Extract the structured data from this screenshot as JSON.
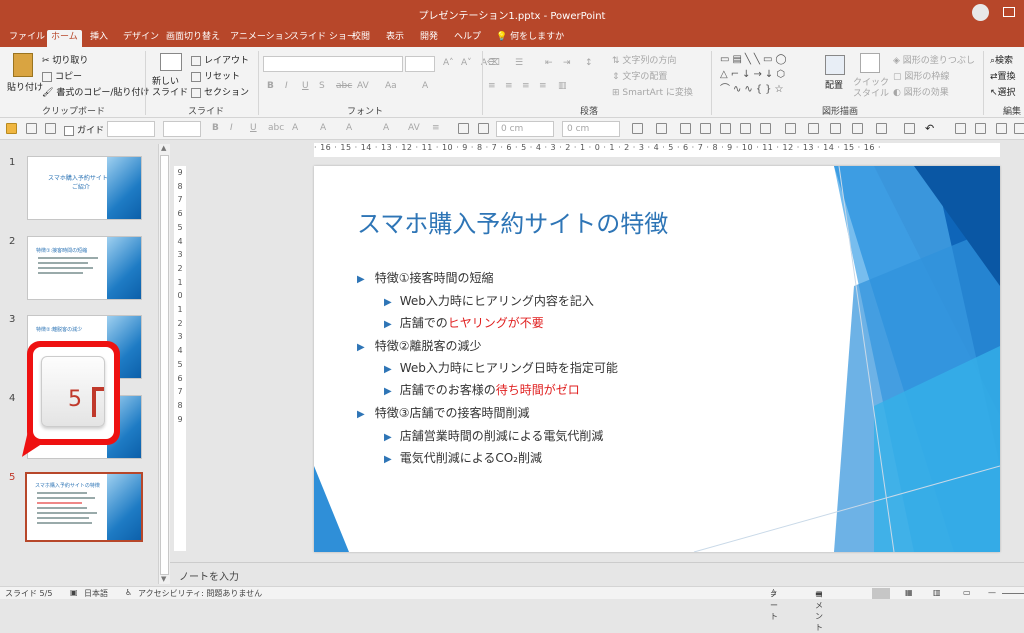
{
  "app": {
    "title": "プレゼンテーション1.pptx  -  PowerPoint"
  },
  "tabs": [
    {
      "label": "ファイル"
    },
    {
      "label": "ホーム"
    },
    {
      "label": "挿入"
    },
    {
      "label": "デザイン"
    },
    {
      "label": "画面切り替え"
    },
    {
      "label": "アニメーション"
    },
    {
      "label": "スライド ショー"
    },
    {
      "label": "校閲"
    },
    {
      "label": "表示"
    },
    {
      "label": "開発"
    },
    {
      "label": "ヘルプ"
    },
    {
      "label": "何をしますか"
    }
  ],
  "ribbon": {
    "clipboard": {
      "paste": "貼り付け",
      "cut": "切り取り",
      "copy": "コピー",
      "format_painter": "書式のコピー/貼り付け",
      "group": "クリップボード"
    },
    "slides": {
      "new_slide": "新しい\nスライド",
      "layout": "レイアウト",
      "reset": "リセット",
      "section": "セクション",
      "group": "スライド"
    },
    "font": {
      "group": "フォント"
    },
    "paragraph": {
      "text_direction": "文字列の方向",
      "align_text": "文字の配置",
      "smartart": "SmartArt に変換",
      "group": "段落"
    },
    "drawing": {
      "arrange": "配置",
      "quick_styles": "クイック\nスタイル",
      "shape_fill": "図形の塗りつぶし",
      "shape_outline": "図形の枠線",
      "shape_effects": "図形の効果",
      "group": "図形描画"
    },
    "editing": {
      "find": "検索",
      "replace": "置換",
      "select": "選択",
      "group": "編集"
    }
  },
  "qat": {
    "guides": "ガイド",
    "width": "0 cm",
    "height": "0 cm"
  },
  "ruler": {
    "h": "· 16 · 15 · 14 · 13 · 12 · 11 · 10 · 9 · 8 · 7 · 6 · 5 · 4 · 3 · 2 · 1 · 0 · 1 · 2 · 3 · 4 · 5 · 6 · 7 · 8 · 9 · 10 · 11 · 12 · 13 · 14 · 15 · 16 ·",
    "v": [
      "9",
      "8",
      "7",
      "6",
      "5",
      "4",
      "3",
      "2",
      "1",
      "0",
      "1",
      "2",
      "3",
      "4",
      "5",
      "6",
      "7",
      "8",
      "9"
    ]
  },
  "thumbnails": [
    {
      "num": "1",
      "title": "スマホ購入予約サイトの\nご紹介"
    },
    {
      "num": "2",
      "title": "特徴①:接客時間の短縮"
    },
    {
      "num": "3",
      "title": "特徴②:離脱客の減少"
    },
    {
      "num": "4",
      "title": ""
    },
    {
      "num": "5",
      "title": "スマホ購入予約サイトの特徴"
    }
  ],
  "callout": {
    "key": "5"
  },
  "slide": {
    "title": "スマホ購入予約サイトの特徴",
    "bullets": [
      {
        "level": 1,
        "text": "特徴①接客時間の短縮"
      },
      {
        "level": 2,
        "text": "Web入力時にヒアリング内容を記入"
      },
      {
        "level": 2,
        "text": "店舗での",
        "highlight": "ヒヤリングが不要"
      },
      {
        "level": 1,
        "text": "特徴②離脱客の減少"
      },
      {
        "level": 2,
        "text": "Web入力時にヒアリング日時を指定可能"
      },
      {
        "level": 2,
        "text": "店舗でのお客様の",
        "highlight": "待ち時間がゼロ"
      },
      {
        "level": 1,
        "text": "特徴③店舗での接客時間削減"
      },
      {
        "level": 2,
        "text": "店舗営業時間の削減による電気代削減"
      },
      {
        "level": 2,
        "text": "電気代削減によるCO₂削減"
      }
    ]
  },
  "notes": {
    "placeholder": "ノートを入力"
  },
  "status": {
    "slide": "スライド 5/5",
    "lang": "日本語",
    "accessibility": "アクセシビリティ: 問題ありません",
    "notes": "ノート",
    "comments": "コメント"
  },
  "colors": {
    "brand": "#b7472a",
    "title": "#2e75b6",
    "highlight": "#e02020"
  }
}
